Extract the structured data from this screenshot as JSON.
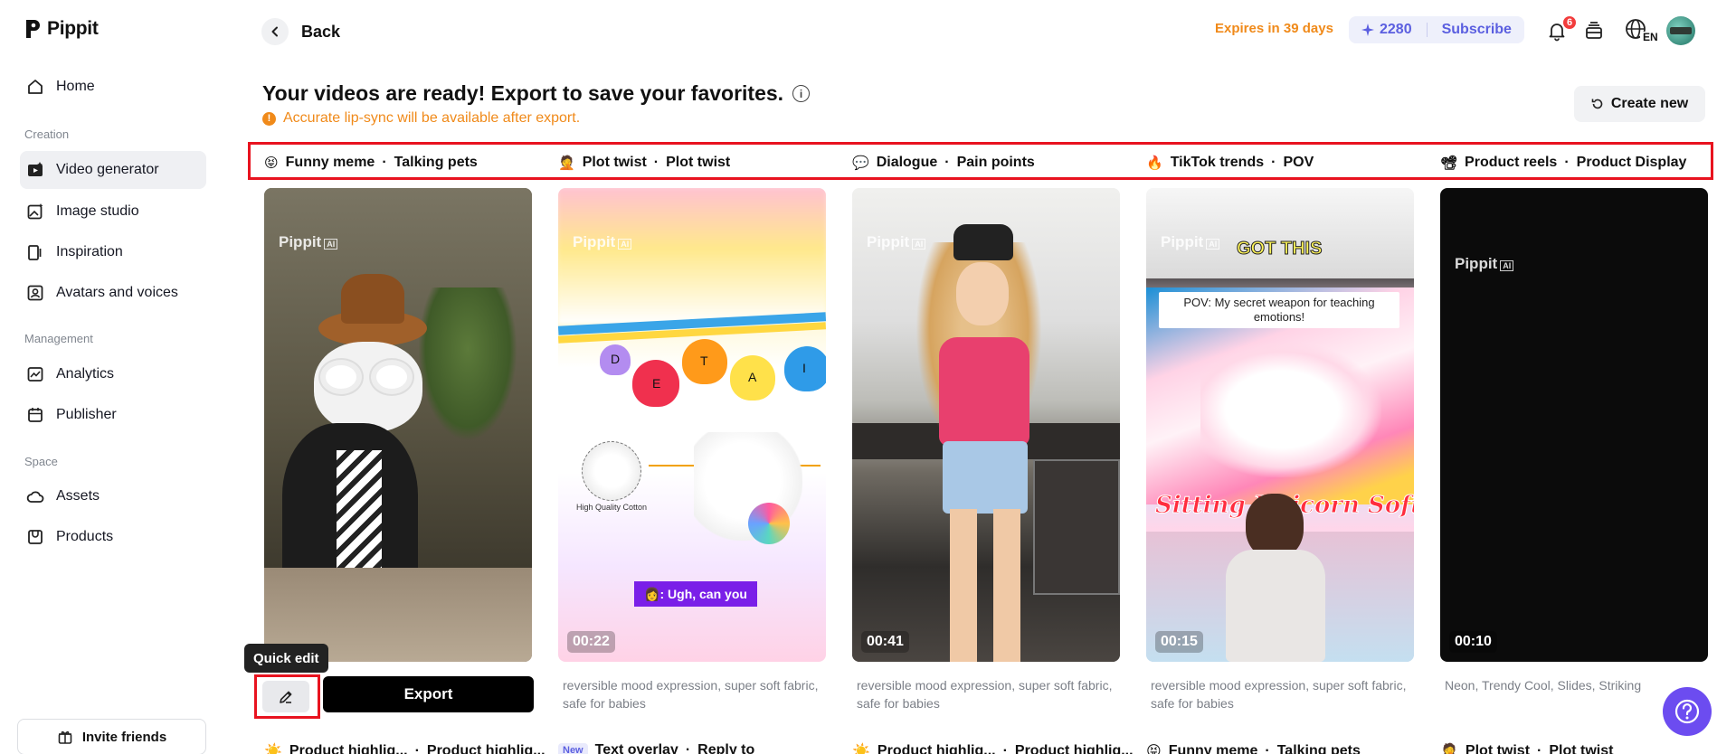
{
  "sidebar": {
    "brand": "Pippit",
    "home": "Home",
    "groups": {
      "creation": "Creation",
      "management": "Management",
      "space": "Space"
    },
    "items": {
      "video_generator": "Video generator",
      "image_studio": "Image studio",
      "inspiration": "Inspiration",
      "avatars": "Avatars and voices",
      "analytics": "Analytics",
      "publisher": "Publisher",
      "assets": "Assets",
      "products": "Products"
    },
    "invite": "Invite friends"
  },
  "header": {
    "back": "Back",
    "expires": "Expires in 39 days",
    "credits": "2280",
    "subscribe": "Subscribe",
    "notif_count": "6",
    "lang": "EN"
  },
  "main": {
    "title": "Your videos are ready! Export to save your favorites.",
    "notice": "Accurate lip-sync will be available after export.",
    "create_new": "Create new"
  },
  "categories": [
    {
      "emoji": "😝",
      "a": "Funny meme",
      "b": "Talking pets"
    },
    {
      "emoji": "🤦",
      "a": "Plot twist",
      "b": "Plot twist"
    },
    {
      "emoji": "💬",
      "a": "Dialogue",
      "b": "Pain points"
    },
    {
      "emoji": "🔥",
      "a": "TikTok trends",
      "b": "POV"
    },
    {
      "emoji": "📽",
      "a": "Product reels",
      "b": "Product Display"
    }
  ],
  "cards": [
    {
      "watermark": "Pippit",
      "duration": "",
      "desc": ""
    },
    {
      "watermark": "Pippit",
      "duration": "00:22",
      "desc": "reversible mood expression, super soft fabric, safe for babies",
      "caption": "👩: Ugh, can you",
      "product_label": "High Quality Cotton"
    },
    {
      "watermark": "Pippit",
      "duration": "00:41",
      "desc": "reversible mood expression, super soft fabric, safe for babies"
    },
    {
      "watermark": "Pippit",
      "duration": "00:15",
      "desc": "reversible mood expression, super soft fabric, safe for babies",
      "top_caption": "GOT THIS",
      "pov": "POV: My secret weapon for teaching emotions!",
      "overlay_text": "Sitting Unicorn Soft"
    },
    {
      "watermark": "Pippit",
      "duration": "00:10",
      "desc": "Neon, Trendy Cool, Slides, Striking"
    }
  ],
  "card1": {
    "quick_edit": "Quick edit",
    "export": "Export"
  },
  "bottom_row": [
    {
      "emoji": "☀️",
      "a": "Product highlig...",
      "b": "Product highlig..."
    },
    {
      "tag": "New",
      "a": "Text overlay",
      "b": "Reply to"
    },
    {
      "emoji": "☀️",
      "a": "Product highlig...",
      "b": "Product highlig..."
    },
    {
      "emoji": "😝",
      "a": "Funny meme",
      "b": "Talking pets"
    },
    {
      "emoji": "🤦",
      "a": "Plot twist",
      "b": "Plot twist"
    }
  ],
  "letters": [
    "D",
    "E",
    "T",
    "A",
    "I"
  ],
  "colors": {
    "accent_orange": "#f08a1a",
    "accent_purple": "#5b5fe0",
    "highlight_red": "#e8131f",
    "help_bg": "#6c4cf0"
  }
}
